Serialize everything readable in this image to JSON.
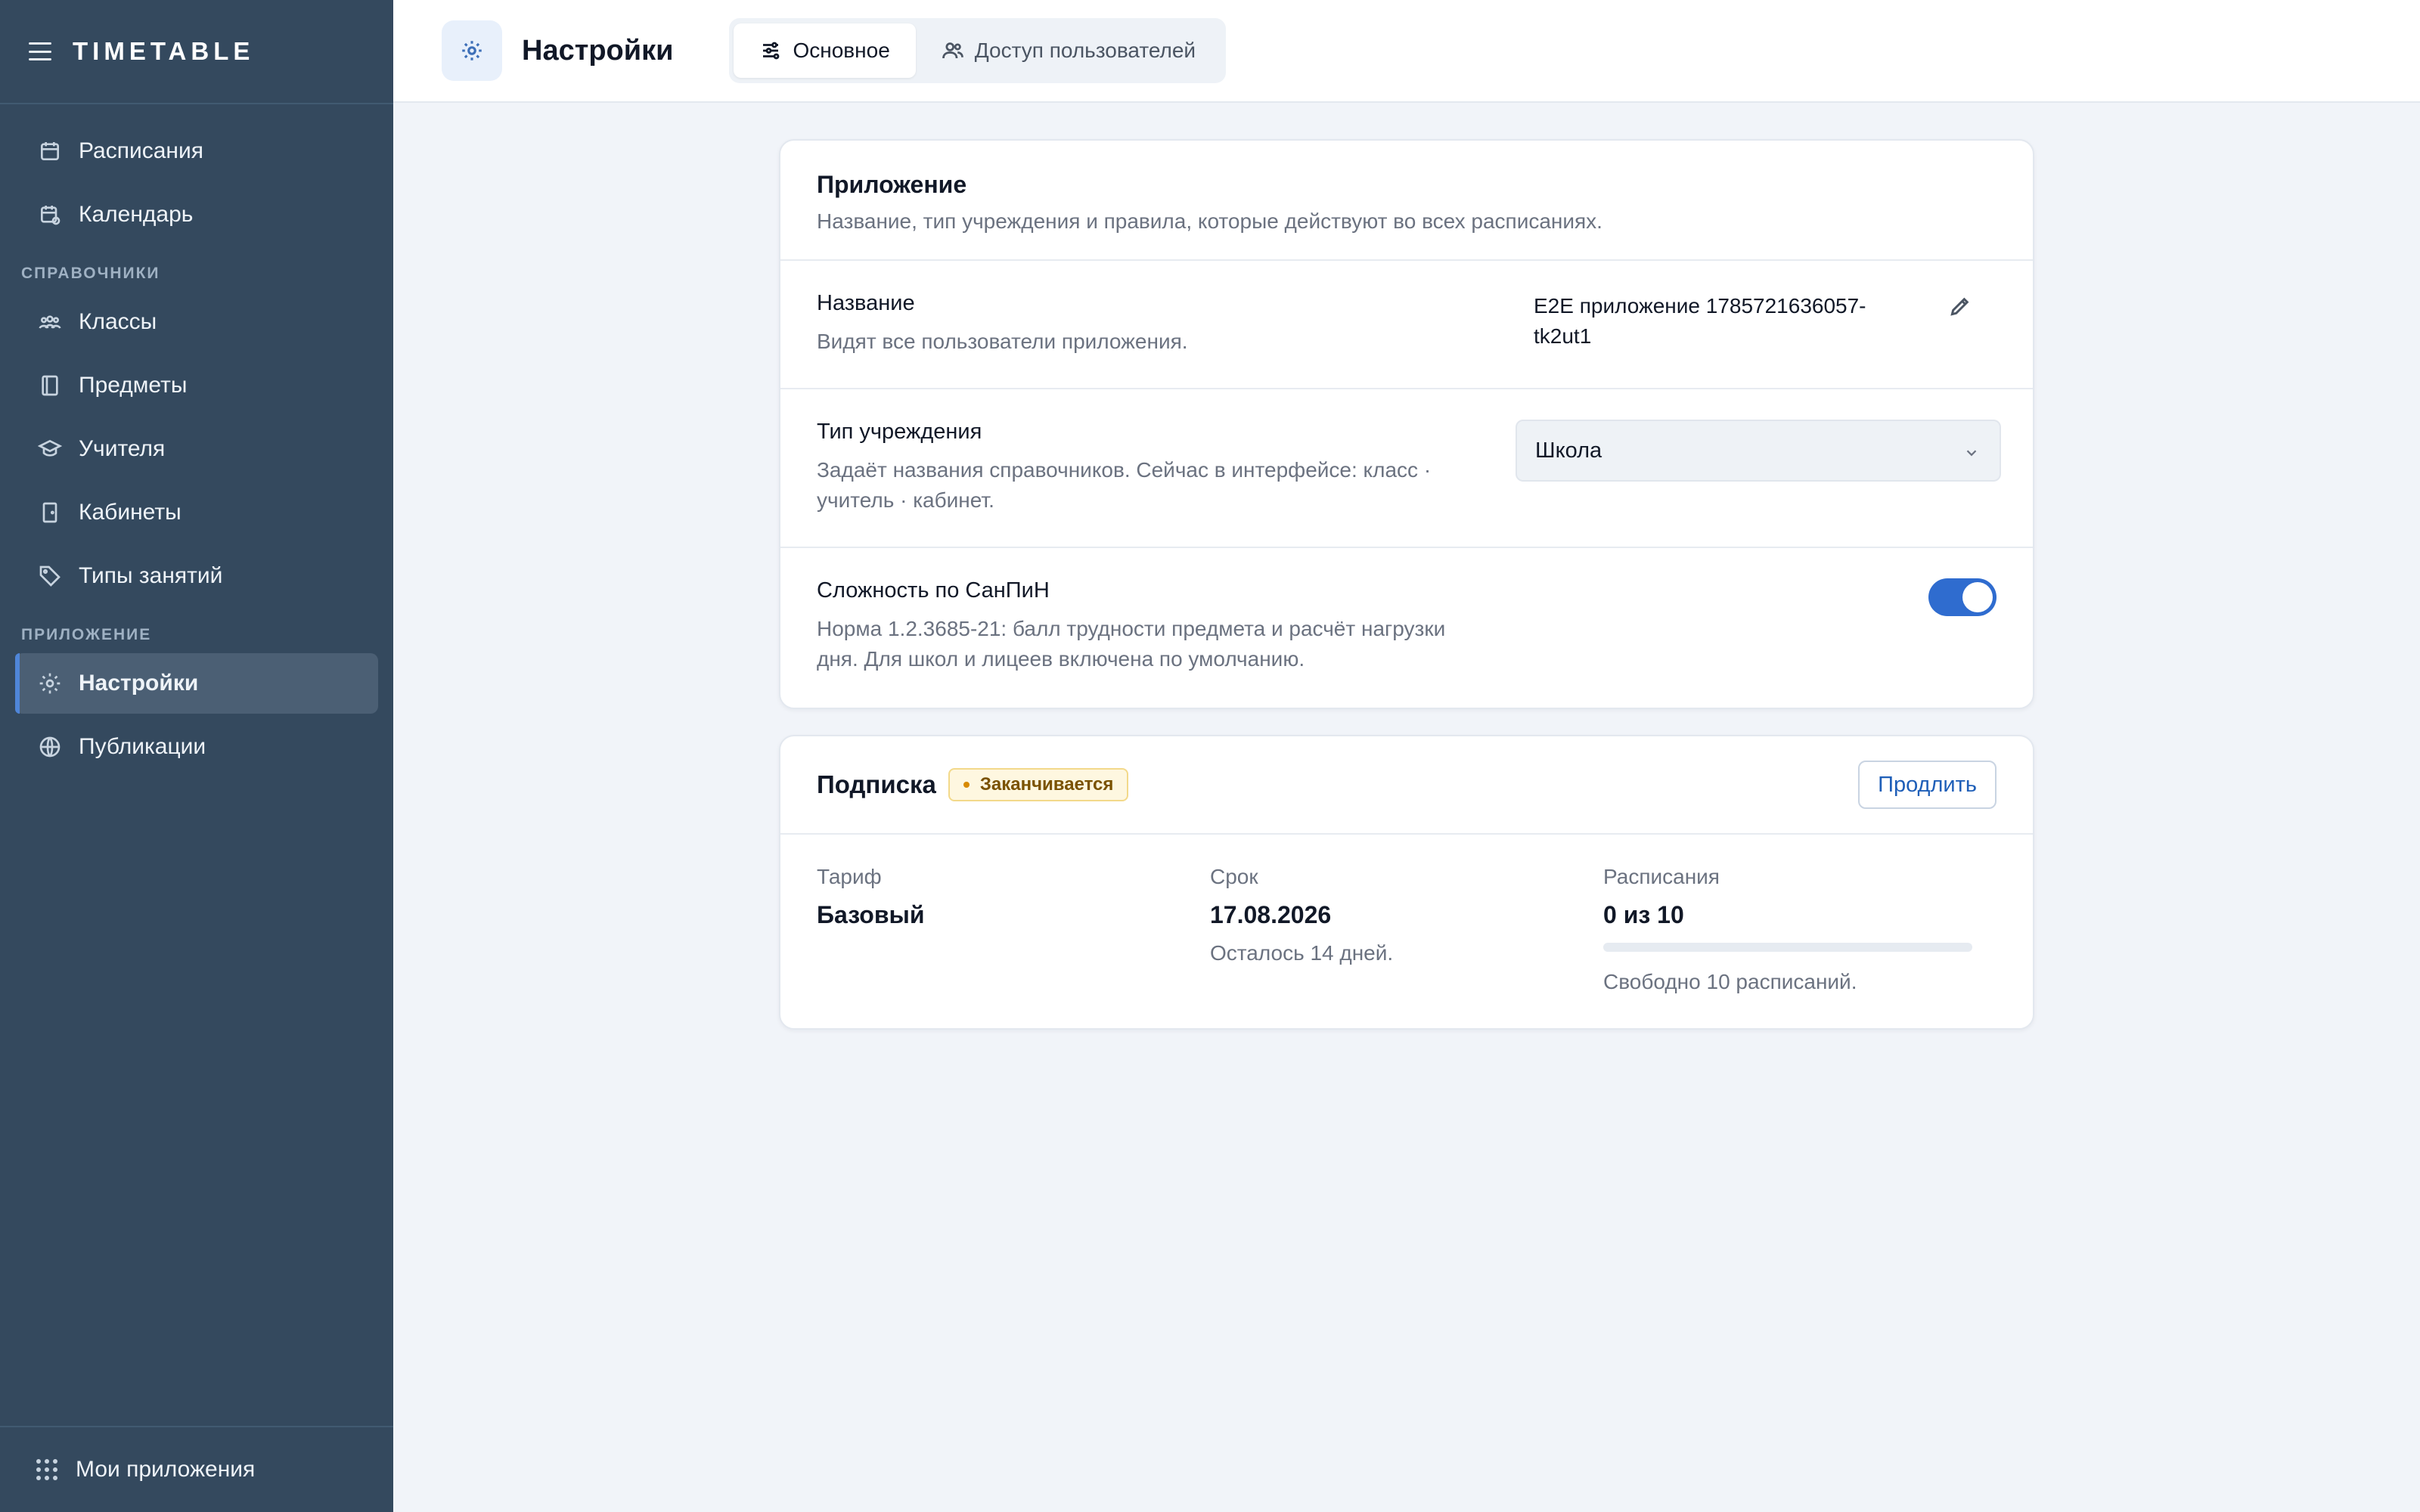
{
  "app": {
    "title": "TIMETABLE"
  },
  "sidebar": {
    "top_items": [
      {
        "label": "Расписания",
        "icon": "calendar-icon"
      },
      {
        "label": "Календарь",
        "icon": "calendar-clock-icon"
      }
    ],
    "sections": [
      {
        "title": "СПРАВОЧНИКИ",
        "items": [
          {
            "label": "Классы",
            "icon": "users-group-icon"
          },
          {
            "label": "Предметы",
            "icon": "book-icon"
          },
          {
            "label": "Учителя",
            "icon": "graduation-cap-icon"
          },
          {
            "label": "Кабинеты",
            "icon": "door-icon"
          },
          {
            "label": "Типы занятий",
            "icon": "tag-icon"
          }
        ]
      },
      {
        "title": "ПРИЛОЖЕНИЕ",
        "items": [
          {
            "label": "Настройки",
            "icon": "gear-icon",
            "active": true
          },
          {
            "label": "Публикации",
            "icon": "globe-icon"
          }
        ]
      }
    ],
    "footer": {
      "label": "Мои приложения",
      "icon": "grid-dots-icon"
    }
  },
  "header": {
    "title": "Настройки",
    "tabs": [
      {
        "label": "Основное",
        "icon": "sliders-icon",
        "active": true
      },
      {
        "label": "Доступ пользователей",
        "icon": "users-icon",
        "active": false
      }
    ]
  },
  "app_card": {
    "title": "Приложение",
    "subtitle": "Название, тип учреждения и правила, которые действуют во всех расписаниях.",
    "name": {
      "label": "Название",
      "description": "Видят все пользователи приложения.",
      "value": "E2E приложение 1785721636057-tk2ut1"
    },
    "institution": {
      "label": "Тип учреждения",
      "description": "Задаёт названия справочников. Сейчас в интерфейсе: класс · учитель · кабинет.",
      "selected": "Школа"
    },
    "sanpin": {
      "label": "Сложность по СанПиН",
      "description": "Норма 1.2.3685-21: балл трудности предмета и расчёт нагрузки дня. Для школ и лицеев включена по умолчанию.",
      "enabled": true
    }
  },
  "subscription": {
    "title": "Подписка",
    "badge": "Заканчивается",
    "renew_label": "Продлить",
    "plan": {
      "label": "Тариф",
      "value": "Базовый"
    },
    "term": {
      "label": "Срок",
      "value": "17.08.2026",
      "note": "Осталось 14 дней."
    },
    "schedules": {
      "label": "Расписания",
      "value": "0 из 10",
      "used": 0,
      "total": 10,
      "note": "Свободно 10 расписаний."
    }
  },
  "colors": {
    "sidebar_bg": "#34495e",
    "accent": "#2f6ccf",
    "warning_badge_bg": "#fef7e0",
    "warning_badge_text": "#7a5200"
  }
}
